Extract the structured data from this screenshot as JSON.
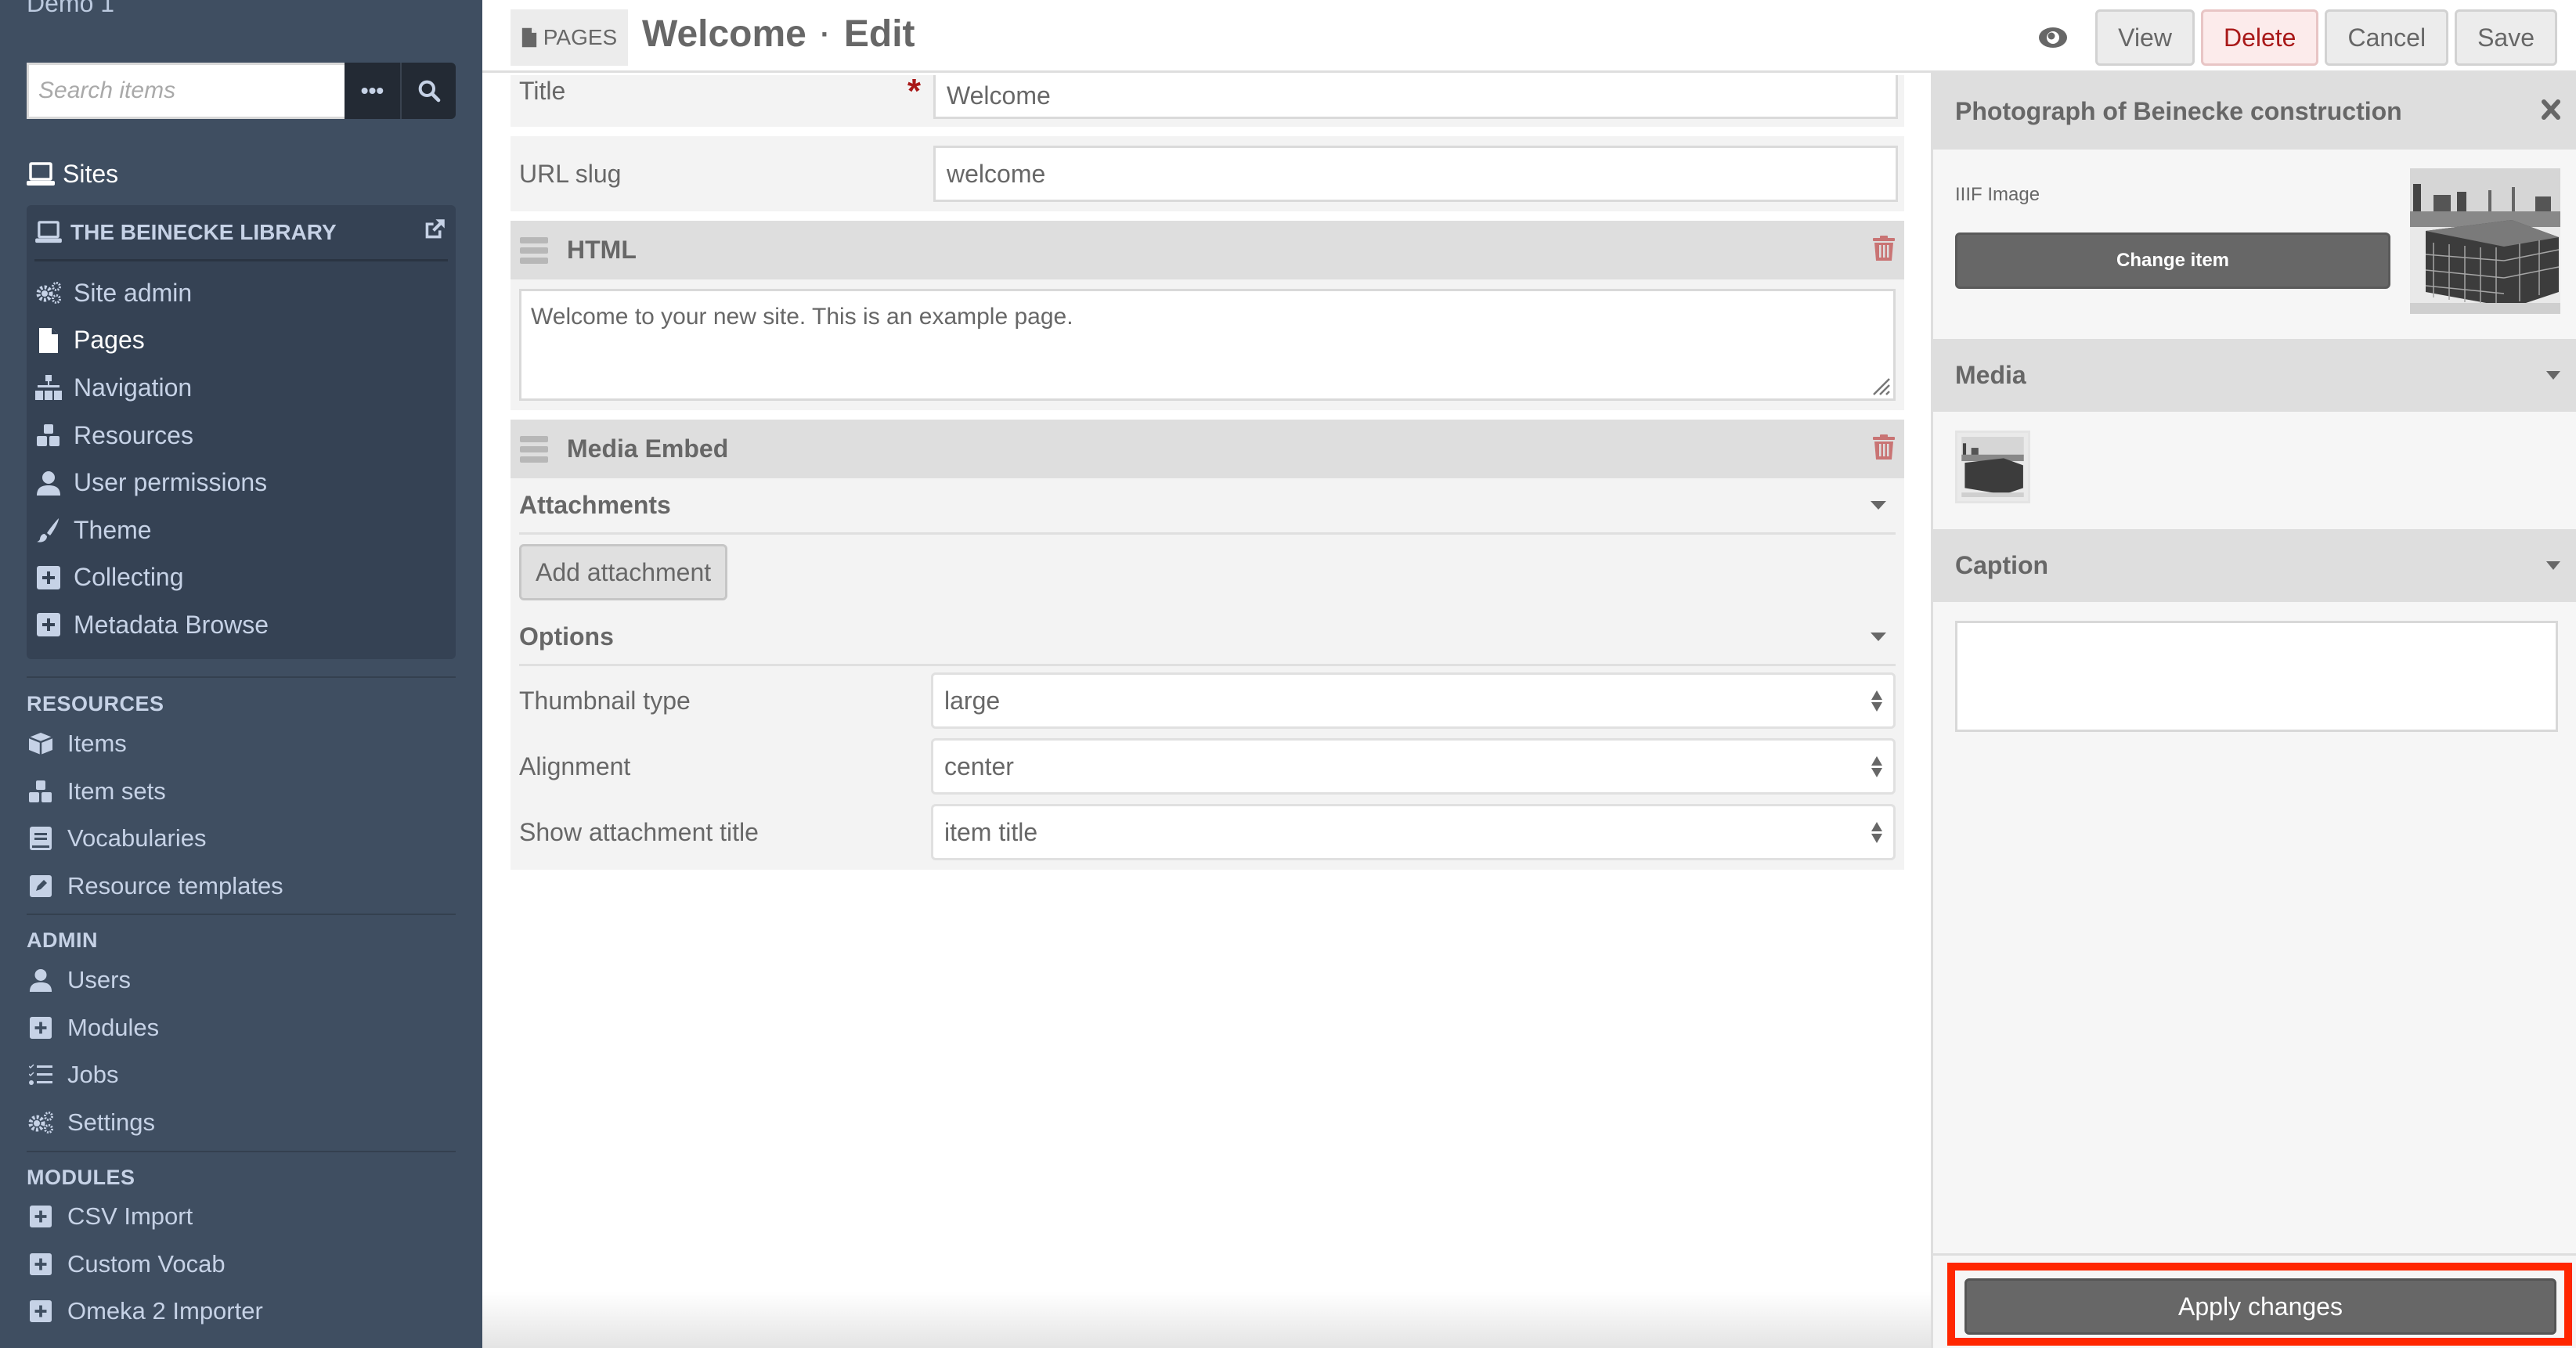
{
  "sidebar": {
    "install_name": "Demo 1",
    "search": {
      "placeholder": "Search items",
      "advanced_icon": "ellipsis-icon",
      "submit_icon": "search-icon"
    },
    "sites_label": "Sites",
    "site": {
      "title": "THE BEINECKE LIBRARY",
      "items": [
        {
          "label": "Site admin",
          "icon": "cogs-icon"
        },
        {
          "label": "Pages",
          "icon": "file-icon",
          "active": true
        },
        {
          "label": "Navigation",
          "icon": "sitemap-icon"
        },
        {
          "label": "Resources",
          "icon": "cubes-icon"
        },
        {
          "label": "User permissions",
          "icon": "user-icon"
        },
        {
          "label": "Theme",
          "icon": "paintbrush-icon"
        },
        {
          "label": "Collecting",
          "icon": "plus-square-icon"
        },
        {
          "label": "Metadata Browse",
          "icon": "plus-square-icon"
        }
      ]
    },
    "sections": [
      {
        "title": "RESOURCES",
        "items": [
          {
            "label": "Items",
            "icon": "cube-icon"
          },
          {
            "label": "Item sets",
            "icon": "cubes-icon"
          },
          {
            "label": "Vocabularies",
            "icon": "book-icon"
          },
          {
            "label": "Resource templates",
            "icon": "edit-icon"
          }
        ]
      },
      {
        "title": "ADMIN",
        "items": [
          {
            "label": "Users",
            "icon": "user-icon"
          },
          {
            "label": "Modules",
            "icon": "plus-square-icon"
          },
          {
            "label": "Jobs",
            "icon": "tasks-icon"
          },
          {
            "label": "Settings",
            "icon": "cogs-icon"
          }
        ]
      },
      {
        "title": "MODULES",
        "items": [
          {
            "label": "CSV Import",
            "icon": "plus-square-icon"
          },
          {
            "label": "Custom Vocab",
            "icon": "plus-square-icon"
          },
          {
            "label": "Omeka 2 Importer",
            "icon": "plus-square-icon"
          }
        ]
      }
    ]
  },
  "header": {
    "breadcrumb": "PAGES",
    "title": "Welcome",
    "separator": "·",
    "action": "Edit",
    "buttons": {
      "view": "View",
      "delete": "Delete",
      "cancel": "Cancel",
      "save": "Save"
    }
  },
  "form": {
    "title_label": "Title",
    "title_value": "Welcome",
    "required_marker": "*",
    "slug_label": "URL slug",
    "slug_value": "welcome",
    "html_block": {
      "heading": "HTML",
      "content": "Welcome to your new site. This is an example page."
    },
    "media_block": {
      "heading": "Media Embed",
      "attachments_heading": "Attachments",
      "add_attachment_label": "Add attachment",
      "options_heading": "Options",
      "options": [
        {
          "label": "Thumbnail type",
          "value": "large"
        },
        {
          "label": "Alignment",
          "value": "center"
        },
        {
          "label": "Show attachment title",
          "value": "item title"
        }
      ]
    }
  },
  "attachment_panel": {
    "title": "Photograph of Beinecke construction",
    "media_type": "IIIF Image",
    "change_item_label": "Change item",
    "media_heading": "Media",
    "caption_heading": "Caption",
    "caption_value": "",
    "apply_label": "Apply changes",
    "highlight_color": "#ff2600"
  }
}
